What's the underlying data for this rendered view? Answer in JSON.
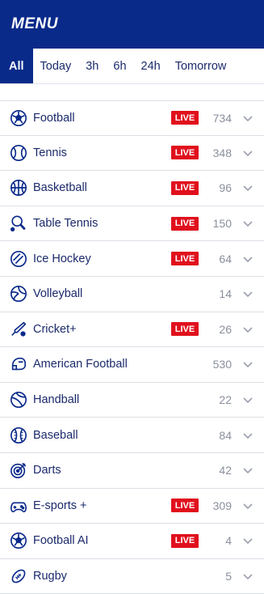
{
  "header": {
    "title": "MENU"
  },
  "tabs": [
    {
      "label": "All",
      "active": true
    },
    {
      "label": "Today",
      "active": false
    },
    {
      "label": "3h",
      "active": false
    },
    {
      "label": "6h",
      "active": false
    },
    {
      "label": "24h",
      "active": false
    },
    {
      "label": "Tomorrow",
      "active": false
    }
  ],
  "sports": [
    {
      "label": "Football",
      "icon": "football-icon",
      "live": "LIVE",
      "count": "734"
    },
    {
      "label": "Tennis",
      "icon": "tennis-icon",
      "live": "LIVE",
      "count": "348"
    },
    {
      "label": "Basketball",
      "icon": "basketball-icon",
      "live": "LIVE",
      "count": "96"
    },
    {
      "label": "Table Tennis",
      "icon": "table-tennis-icon",
      "live": "LIVE",
      "count": "150"
    },
    {
      "label": "Ice Hockey",
      "icon": "ice-hockey-icon",
      "live": "LIVE",
      "count": "64"
    },
    {
      "label": "Volleyball",
      "icon": "volleyball-icon",
      "live": null,
      "count": "14"
    },
    {
      "label": "Cricket+",
      "icon": "cricket-icon",
      "live": "LIVE",
      "count": "26"
    },
    {
      "label": "American Football",
      "icon": "american-football-icon",
      "live": null,
      "count": "530"
    },
    {
      "label": "Handball",
      "icon": "handball-icon",
      "live": null,
      "count": "22"
    },
    {
      "label": "Baseball",
      "icon": "baseball-icon",
      "live": null,
      "count": "84"
    },
    {
      "label": "Darts",
      "icon": "darts-icon",
      "live": null,
      "count": "42"
    },
    {
      "label": "E-sports +",
      "icon": "esports-icon",
      "live": "LIVE",
      "count": "309"
    },
    {
      "label": "Football AI",
      "icon": "football-icon",
      "live": "LIVE",
      "count": "4"
    },
    {
      "label": "Rugby",
      "icon": "rugby-icon",
      "live": null,
      "count": "5"
    }
  ],
  "colors": {
    "brand": "#0a2a8a",
    "live": "#e0101c",
    "text": "#1b2a6b",
    "muted": "#8a8f9c"
  }
}
